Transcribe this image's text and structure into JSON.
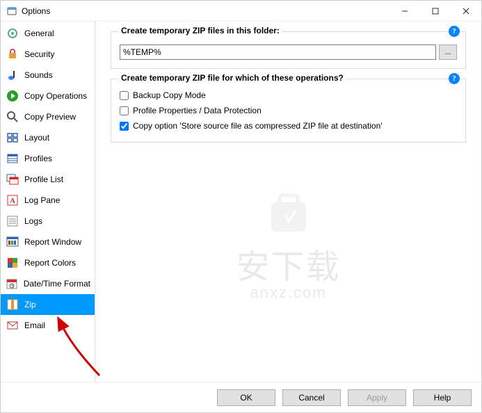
{
  "window": {
    "title": "Options"
  },
  "sidebar": {
    "items": [
      {
        "label": "General"
      },
      {
        "label": "Security"
      },
      {
        "label": "Sounds"
      },
      {
        "label": "Copy Operations"
      },
      {
        "label": "Copy Preview"
      },
      {
        "label": "Layout"
      },
      {
        "label": "Profiles"
      },
      {
        "label": "Profile List"
      },
      {
        "label": "Log Pane"
      },
      {
        "label": "Logs"
      },
      {
        "label": "Report Window"
      },
      {
        "label": "Report Colors"
      },
      {
        "label": "Date/Time Format"
      },
      {
        "label": "Zip"
      },
      {
        "label": "Email"
      }
    ],
    "selected_index": 13
  },
  "group_folder": {
    "title": "Create temporary ZIP files in this folder:",
    "path_value": "%TEMP%",
    "browse_label": "..."
  },
  "group_ops": {
    "title": "Create temporary ZIP file for which of these operations?",
    "checks": [
      {
        "label": "Backup Copy Mode",
        "checked": false
      },
      {
        "label": "Profile Properties / Data Protection",
        "checked": false
      },
      {
        "label": "Copy option 'Store source file as compressed ZIP file at destination'",
        "checked": true
      }
    ]
  },
  "footer": {
    "ok": "OK",
    "cancel": "Cancel",
    "apply": "Apply",
    "help": "Help"
  },
  "colors": {
    "selection": "#0099ff",
    "help_badge": "#0a84ff"
  }
}
